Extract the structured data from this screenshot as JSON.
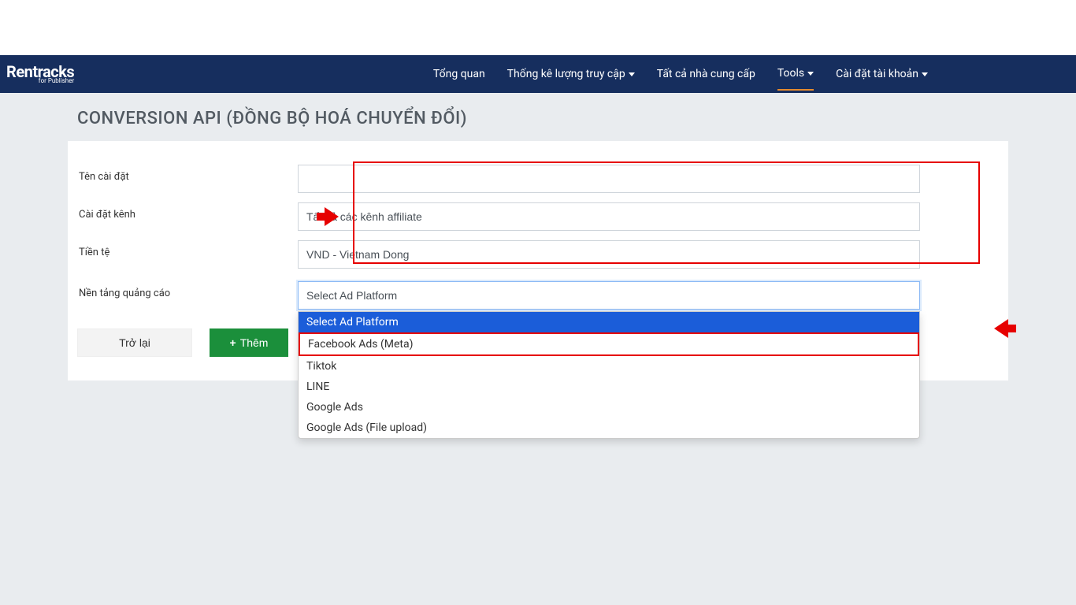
{
  "brand": {
    "name": "Rentracks",
    "sub": "for Publisher"
  },
  "nav": {
    "items": [
      {
        "label": "Tổng quan",
        "dropdown": false
      },
      {
        "label": "Thống kê lượng truy cập",
        "dropdown": true
      },
      {
        "label": "Tất cả nhà cung cấp",
        "dropdown": false
      },
      {
        "label": "Tools",
        "dropdown": true,
        "active": true
      },
      {
        "label": "Cài đặt tài khoản",
        "dropdown": true
      }
    ]
  },
  "page": {
    "title": "CONVERSION API (ĐỒNG BỘ HOÁ CHUYỂN ĐỔI)"
  },
  "form": {
    "setting_name": {
      "label": "Tên cài đặt",
      "value": ""
    },
    "channel_setting": {
      "label": "Cài đặt kênh",
      "value": "Tất cả các kênh affiliate"
    },
    "currency": {
      "label": "Tiền tệ",
      "value": "VND - Vietnam Dong"
    },
    "ad_platform": {
      "label": "Nền tảng quảng cáo",
      "selected": "Select Ad Platform",
      "options": [
        "Select Ad Platform",
        "Facebook Ads (Meta)",
        "Tiktok",
        "LINE",
        "Google Ads",
        "Google Ads (File upload)"
      ]
    }
  },
  "buttons": {
    "back": "Trở lại",
    "add": "Thêm"
  }
}
